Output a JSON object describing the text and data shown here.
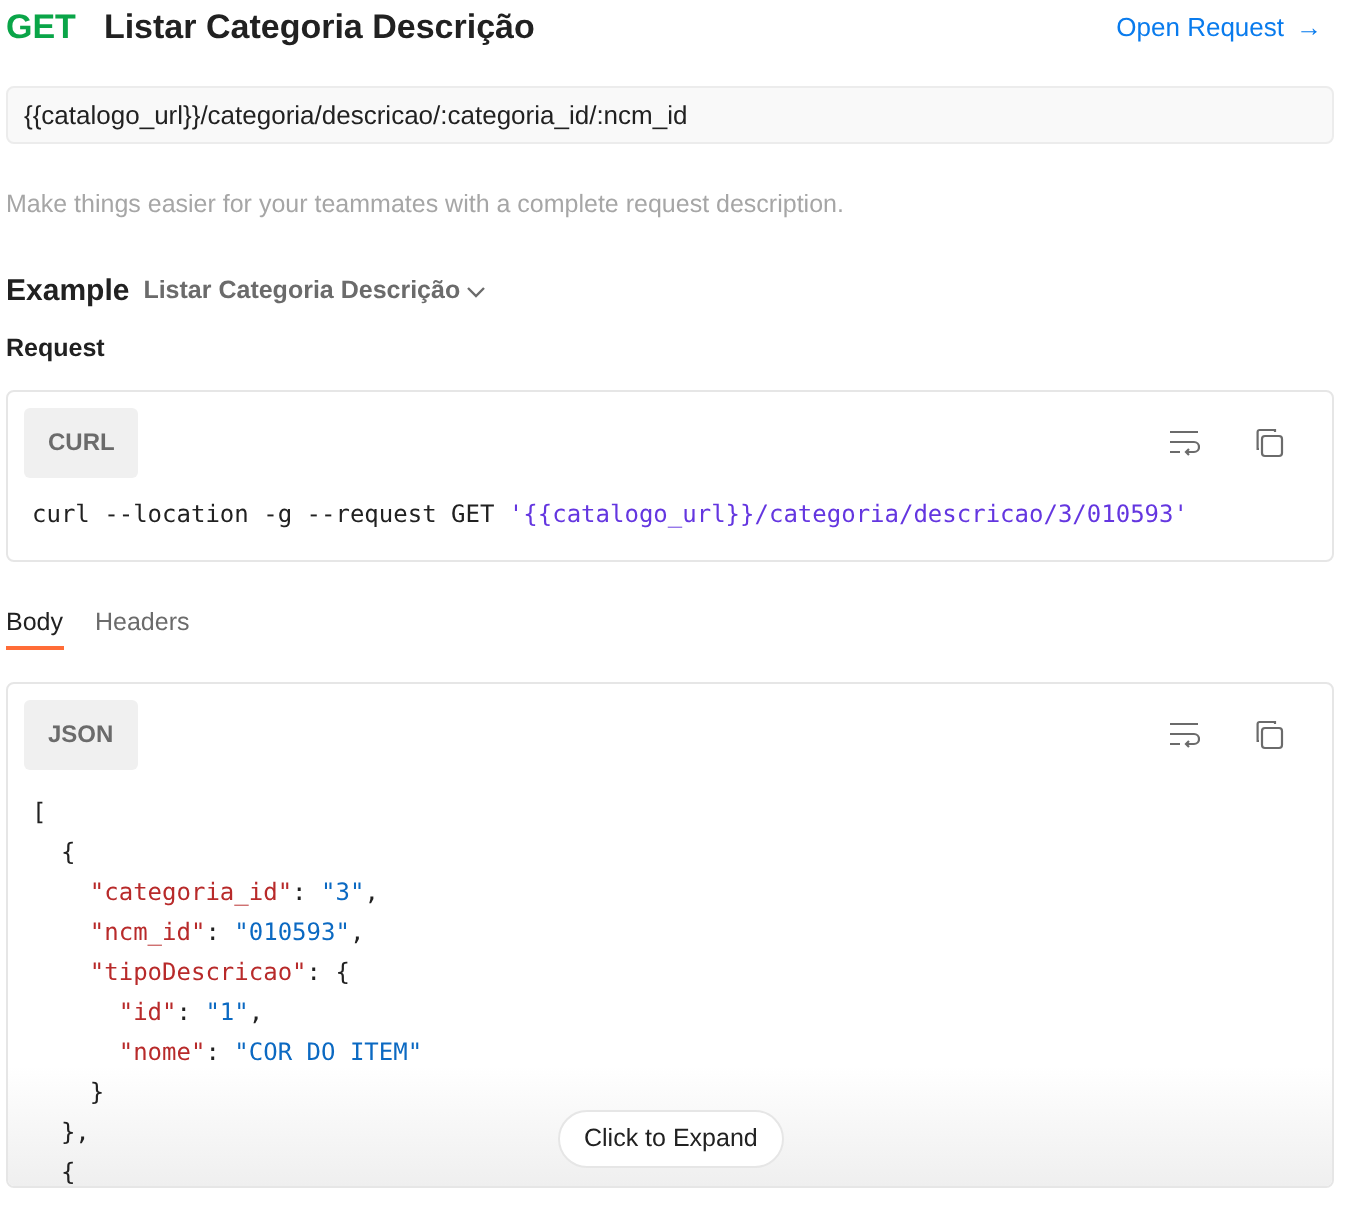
{
  "header": {
    "method": "GET",
    "title": "Listar Categoria Descrição",
    "open_link": "Open Request",
    "open_arrow": "→"
  },
  "url": "{{catalogo_url}}/categoria/descricao/:categoria_id/:ncm_id",
  "description_placeholder": "Make things easier for your teammates with a complete request description.",
  "example": {
    "label": "Example",
    "name": "Listar Categoria Descrição"
  },
  "request": {
    "heading": "Request",
    "language": "CURL",
    "segments": [
      {
        "kind": "plain",
        "text": "curl --location -g --request GET "
      },
      {
        "kind": "string",
        "text": "'{{catalogo_url}}/categoria/descricao/3/010593'"
      }
    ]
  },
  "tabs": [
    {
      "label": "Body",
      "selected": true
    },
    {
      "label": "Headers",
      "selected": false
    }
  ],
  "response": {
    "language": "JSON",
    "lines": [
      [
        {
          "kind": "punct",
          "text": "["
        }
      ],
      [
        {
          "kind": "punct",
          "text": "  {"
        }
      ],
      [
        {
          "kind": "key",
          "text": "    \"categoria_id\""
        },
        {
          "kind": "punct",
          "text": ": "
        },
        {
          "kind": "value",
          "text": "\"3\""
        },
        {
          "kind": "punct",
          "text": ","
        }
      ],
      [
        {
          "kind": "key",
          "text": "    \"ncm_id\""
        },
        {
          "kind": "punct",
          "text": ": "
        },
        {
          "kind": "value",
          "text": "\"010593\""
        },
        {
          "kind": "punct",
          "text": ","
        }
      ],
      [
        {
          "kind": "key",
          "text": "    \"tipoDescricao\""
        },
        {
          "kind": "punct",
          "text": ": {"
        }
      ],
      [
        {
          "kind": "key",
          "text": "      \"id\""
        },
        {
          "kind": "punct",
          "text": ": "
        },
        {
          "kind": "value",
          "text": "\"1\""
        },
        {
          "kind": "punct",
          "text": ","
        }
      ],
      [
        {
          "kind": "key",
          "text": "      \"nome\""
        },
        {
          "kind": "punct",
          "text": ": "
        },
        {
          "kind": "value",
          "text": "\"COR DO ITEM\""
        }
      ],
      [
        {
          "kind": "punct",
          "text": "    }"
        }
      ],
      [
        {
          "kind": "punct",
          "text": "  },"
        }
      ],
      [
        {
          "kind": "punct",
          "text": "  {"
        }
      ]
    ],
    "expand": "Click to Expand"
  }
}
